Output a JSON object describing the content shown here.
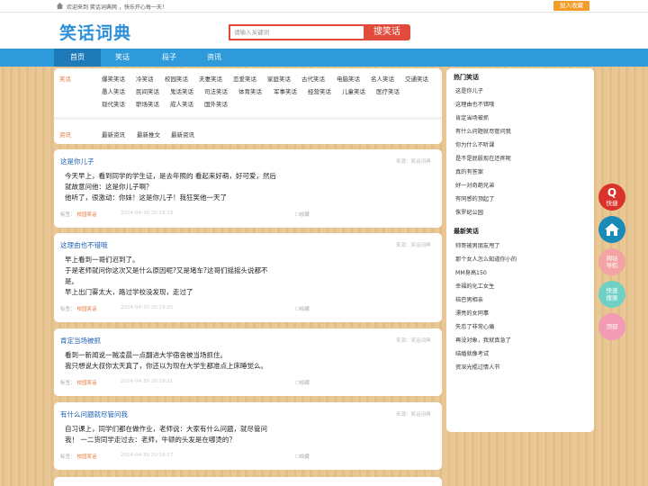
{
  "topbar": {
    "welcome": "欢迎来到 笑话词典网 ，快乐开心每一天！",
    "fav_button": "加入收藏"
  },
  "header": {
    "logo": "笑话词典",
    "search_placeholder": "请输入关键词",
    "search_button": "搜笑话"
  },
  "nav": [
    "首页",
    "笑话",
    "段子",
    "资讯"
  ],
  "categories": {
    "joke_head": "笑话",
    "joke_links": [
      [
        "爆笑笑话",
        "冷笑话",
        "校园笑话",
        "夫妻笑话",
        "恋爱笑话",
        "家庭笑话",
        "古代笑话",
        "电脑笑话",
        "名人笑话",
        "交通笑话"
      ],
      [
        "愚人笑话",
        "民间笑话",
        "鬼话笑话",
        "司法笑话",
        "体育笑话",
        "军事笑话",
        "经营笑话",
        "儿童笑话",
        "医疗笑话"
      ],
      [
        "现代笑话",
        "职场笑话",
        "成人笑话",
        "国外笑话"
      ]
    ],
    "news_head": "资讯",
    "news_links": [
      "最新资讯",
      "最新推文",
      "最新资讯"
    ]
  },
  "posts": [
    {
      "title": "这是你儿子",
      "source": "来源：笑话词典",
      "body": [
        "今天早上，看到同学的学生证，是去年照的 看起来好萌，好可爱，然后",
        "就故意问他：这是你儿子啊？",
        "他听了，很激动：你妹！这是你儿子！我狂笑他一天了"
      ],
      "tag_label": "标签：",
      "tag": "校园笑话",
      "time": "2024-04-30 20:19:19",
      "fav": "☐收藏"
    },
    {
      "title": "这理由也不错哦",
      "source": "来源：笑话词典",
      "body": [
        "早上看到一哥们迟到了。",
        "于是老师就问你这次又是什么原因呢?又是堵车?这哥们摇摇头说都不",
        "是。",
        "早上出门雾太大，路过学校没发现，走过了"
      ],
      "tag_label": "标签：",
      "tag": "校园笑话",
      "time": "2024-04-30 20:19:25",
      "fav": "☐收藏"
    },
    {
      "title": "肯定当场被抓",
      "source": "来源：笑话词典",
      "body": [
        "看到一新闻说一贼凌晨一点翻进大学宿舍被当场抓住。",
        "我只想说大叔你太天真了，你还以为现在大学生都准点上床睡觉么。"
      ],
      "tag_label": "标签：",
      "tag": "校园笑话",
      "time": "2024-04-30 20:19:21",
      "fav": "☐收藏"
    },
    {
      "title": "有什么问题就尽管问我",
      "source": "来源：笑话词典",
      "body": [
        "自习课上，同学们都在做作业，老师说：大家有什么问题，就尽管问",
        "我！ 一二货同学走过去：老师，牛顿的头发是在哪烫的？"
      ],
      "tag_label": "标签：",
      "tag": "校园笑话",
      "time": "2024-04-30 20:19:17",
      "fav": "☐收藏"
    }
  ],
  "sidebar": {
    "hot_head": "热门笑话",
    "hot": [
      "这是你儿子",
      "这理由也不错哦",
      "肯定当场被抓",
      "有什么问题就尽管问我",
      "你为什么不听课",
      "是不是屁股现在还疼呢",
      "真的有答案",
      "好一对奇葩兄弟",
      "有同感的顶起了",
      "侏罗纪公园"
    ],
    "new_head": "最新笑话",
    "new": [
      "帅哥被男朋友甩了",
      "那个女人怎么知道你小的",
      "MM身高150",
      "幸福的化工女生",
      "桔巴男相亲",
      "漂亮的女同事",
      "失恋了非常心痛",
      "再没对象，我就真急了",
      "结婚就像考试",
      "资深光棍过情人节"
    ]
  },
  "floats": {
    "qq": "快捷",
    "nav": [
      "网站",
      "导航"
    ],
    "search": [
      "快速",
      "搜索"
    ],
    "top": "顶部"
  },
  "colors": {
    "brand": "#2c8fd8",
    "nav": "#2e9ad9",
    "accent": "#e24b3b",
    "tag": "#e6773a"
  }
}
